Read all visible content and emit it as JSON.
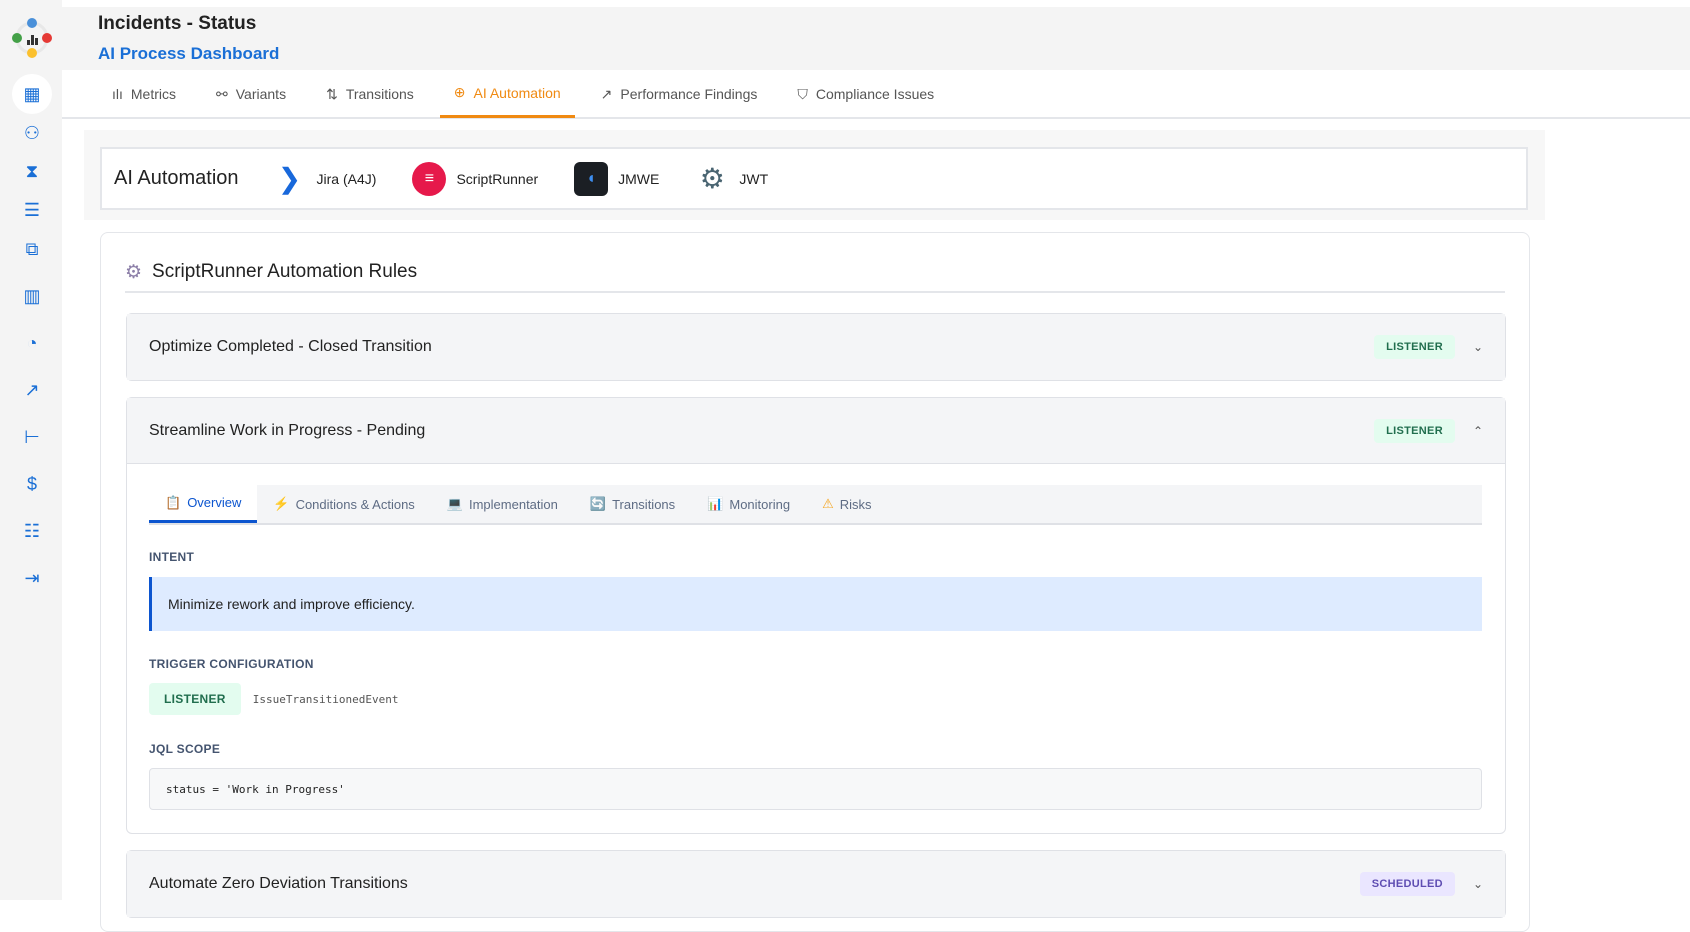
{
  "header": {
    "title": "Incidents - Status",
    "subtitle": "AI Process Dashboard"
  },
  "tabs": [
    {
      "label": "Metrics",
      "icon": "bar-chart-icon"
    },
    {
      "label": "Variants",
      "icon": "variants-icon"
    },
    {
      "label": "Transitions",
      "icon": "transitions-icon"
    },
    {
      "label": "AI Automation",
      "icon": "brain-icon"
    },
    {
      "label": "Performance Findings",
      "icon": "trend-icon"
    },
    {
      "label": "Compliance Issues",
      "icon": "shield-icon"
    }
  ],
  "automation": {
    "title": "AI Automation",
    "tools": [
      "Jira (A4J)",
      "ScriptRunner",
      "JMWE",
      "JWT"
    ]
  },
  "rules": {
    "title": "ScriptRunner Automation Rules",
    "items": [
      {
        "name": "Optimize Completed - Closed Transition",
        "badge": "LISTENER",
        "chevron": "⌄"
      },
      {
        "name": "Streamline Work in Progress - Pending",
        "badge": "LISTENER",
        "chevron": "⌃",
        "subtabs": [
          "Overview",
          "Conditions & Actions",
          "Implementation",
          "Transitions",
          "Monitoring",
          "Risks"
        ],
        "intent_label": "INTENT",
        "intent": "Minimize rework and improve efficiency.",
        "trigger_label": "TRIGGER CONFIGURATION",
        "trigger_type": "LISTENER",
        "trigger_event": "IssueTransitionedEvent",
        "jql_label": "JQL SCOPE",
        "jql": "status = 'Work in Progress'"
      },
      {
        "name": "Automate Zero Deviation Transitions",
        "badge": "SCHEDULED",
        "chevron": "⌄"
      }
    ]
  }
}
